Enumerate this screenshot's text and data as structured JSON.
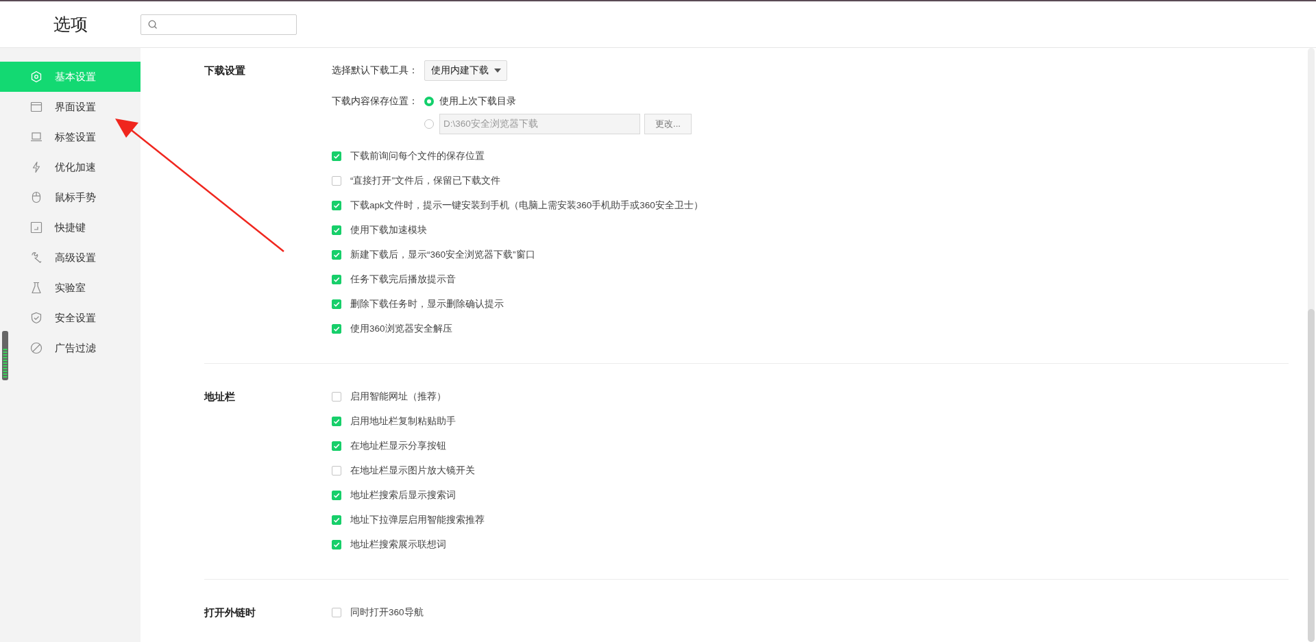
{
  "window": {
    "title": "选项"
  },
  "sidebar": {
    "items": [
      {
        "label": "基本设置",
        "selected": true
      },
      {
        "label": "界面设置",
        "selected": false
      },
      {
        "label": "标签设置",
        "selected": false
      },
      {
        "label": "优化加速",
        "selected": false
      },
      {
        "label": "鼠标手势",
        "selected": false
      },
      {
        "label": "快捷键",
        "selected": false
      },
      {
        "label": "高级设置",
        "selected": false
      },
      {
        "label": "实验室",
        "selected": false
      },
      {
        "label": "安全设置",
        "selected": false
      },
      {
        "label": "广告过滤",
        "selected": false
      }
    ]
  },
  "sections": [
    {
      "title": "下载设置",
      "rows": [
        {
          "kind": "dropdown",
          "label": "选择默认下载工具：",
          "value": "使用内建下载"
        },
        {
          "kind": "radio",
          "label": "下载内容保存位置：",
          "option": "使用上次下载目录",
          "selected": true
        },
        {
          "kind": "path",
          "value": "D:\\360安全浏览器下载",
          "button": "更改...",
          "selected": false
        },
        {
          "kind": "checkbox",
          "label": "下载前询问每个文件的保存位置",
          "checked": true
        },
        {
          "kind": "checkbox",
          "label": "“直接打开”文件后，保留已下载文件",
          "checked": false
        },
        {
          "kind": "checkbox",
          "label": "下载apk文件时，提示一键安装到手机（电脑上需安装360手机助手或360安全卫士）",
          "checked": true
        },
        {
          "kind": "checkbox",
          "label": "使用下载加速模块",
          "checked": true
        },
        {
          "kind": "checkbox",
          "label": "新建下载后，显示“360安全浏览器下载”窗口",
          "checked": true
        },
        {
          "kind": "checkbox",
          "label": "任务下载完后播放提示音",
          "checked": true
        },
        {
          "kind": "checkbox",
          "label": "删除下载任务时，显示删除确认提示",
          "checked": true
        },
        {
          "kind": "checkbox",
          "label": "使用360浏览器安全解压",
          "checked": true
        }
      ]
    },
    {
      "title": "地址栏",
      "rows": [
        {
          "kind": "checkbox",
          "label": "启用智能网址（推荐）",
          "checked": false
        },
        {
          "kind": "checkbox",
          "label": "启用地址栏复制粘贴助手",
          "checked": true
        },
        {
          "kind": "checkbox",
          "label": "在地址栏显示分享按钮",
          "checked": true
        },
        {
          "kind": "checkbox",
          "label": "在地址栏显示图片放大镜开关",
          "checked": false
        },
        {
          "kind": "checkbox",
          "label": "地址栏搜索后显示搜索词",
          "checked": true
        },
        {
          "kind": "checkbox",
          "label": "地址下拉弹层启用智能搜索推荐",
          "checked": true
        },
        {
          "kind": "checkbox",
          "label": "地址栏搜索展示联想词",
          "checked": true
        }
      ]
    },
    {
      "title": "打开外链时",
      "rows": [
        {
          "kind": "checkbox",
          "label": "同时打开360导航",
          "checked": false
        }
      ]
    }
  ]
}
